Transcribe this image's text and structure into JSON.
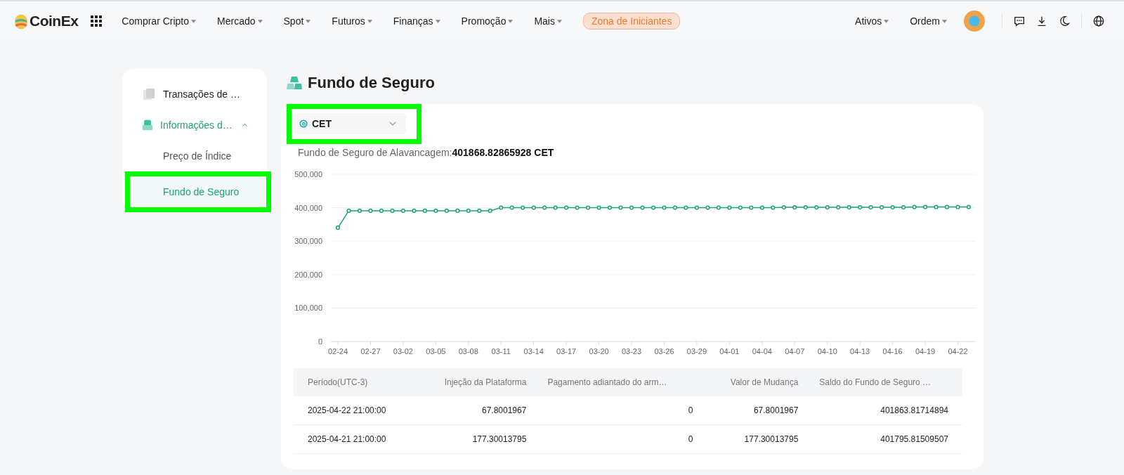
{
  "nav": {
    "logo": "CoinEx",
    "items": [
      {
        "label": "Comprar Cripto"
      },
      {
        "label": "Mercado"
      },
      {
        "label": "Spot"
      },
      {
        "label": "Futuros"
      },
      {
        "label": "Finanças"
      },
      {
        "label": "Promoção"
      },
      {
        "label": "Mais"
      }
    ],
    "badge": "Zona de Iniciantes",
    "right_items": [
      {
        "label": "Ativos"
      },
      {
        "label": "Ordem"
      }
    ]
  },
  "sidebar": {
    "items": [
      {
        "label": "Transações de …",
        "expanded": false
      },
      {
        "label": "Informações d…",
        "expanded": true,
        "children": [
          {
            "label": "Preço de Índice",
            "selected": false,
            "highlighted": false
          },
          {
            "label": "Fundo de Seguro",
            "selected": true,
            "highlighted": true
          }
        ]
      }
    ]
  },
  "page_title": "Fundo de Seguro",
  "coin_select": {
    "value": "CET",
    "highlighted": true
  },
  "summary": {
    "label": "Fundo de Seguro de Alavancagem:",
    "value": "401868.82865928 CET"
  },
  "chart_data": {
    "type": "line",
    "grid": true,
    "categories": [
      "02-24",
      null,
      null,
      "02-27",
      null,
      null,
      "03-02",
      null,
      null,
      "03-05",
      null,
      null,
      "03-08",
      null,
      null,
      "03-11",
      null,
      null,
      "03-14",
      null,
      null,
      "03-17",
      null,
      null,
      "03-20",
      null,
      null,
      "03-23",
      null,
      null,
      "03-26",
      null,
      null,
      "03-29",
      null,
      null,
      "04-01",
      null,
      null,
      "04-04",
      null,
      null,
      "04-07",
      null,
      null,
      "04-10",
      null,
      null,
      "04-13",
      null,
      null,
      "04-16",
      null,
      null,
      "04-19",
      null,
      null,
      "04-22",
      null
    ],
    "series": [
      {
        "color": "#1ba27a",
        "marker": "circle",
        "values": [
          340000,
          391000,
          391000,
          391000,
          391000,
          391000,
          391000,
          391000,
          391000,
          391000,
          391000,
          391000,
          391000,
          391000,
          391000,
          400000,
          400000,
          400000,
          400000,
          400000,
          400000,
          400000,
          400000,
          400000,
          400000,
          400000,
          400000,
          400000,
          400000,
          400000,
          400000,
          400000,
          400000,
          400000,
          400000,
          400000,
          400000,
          400000,
          400000,
          400000,
          400000,
          401000,
          401000,
          401000,
          401000,
          401000,
          401000,
          401000,
          401000,
          401000,
          401000,
          401000,
          401000,
          402000,
          402000,
          402000,
          402000,
          402000,
          402000
        ]
      }
    ],
    "ylim": [
      0,
      500000
    ],
    "yticks": [
      {
        "value": 0,
        "label": "0"
      },
      {
        "value": 100000,
        "label": "100,000"
      },
      {
        "value": 200000,
        "label": "200,000"
      },
      {
        "value": 300000,
        "label": "300,000"
      },
      {
        "value": 400000,
        "label": "400,000"
      },
      {
        "value": 500000,
        "label": "500,000"
      }
    ]
  },
  "table": {
    "columns": [
      "Período(UTC-3)",
      "Injeção da Plataforma",
      "Pagamento adiantado do arm…",
      "Valor de Mudança",
      "Saldo do Fundo de Seguro …"
    ],
    "rows": [
      [
        "2025-04-22 21:00:00",
        "67.8001967",
        "0",
        "67.8001967",
        "401863.81714894"
      ],
      [
        "2025-04-21 21:00:00",
        "177.30013795",
        "0",
        "177.30013795",
        "401795.81509507"
      ]
    ]
  }
}
